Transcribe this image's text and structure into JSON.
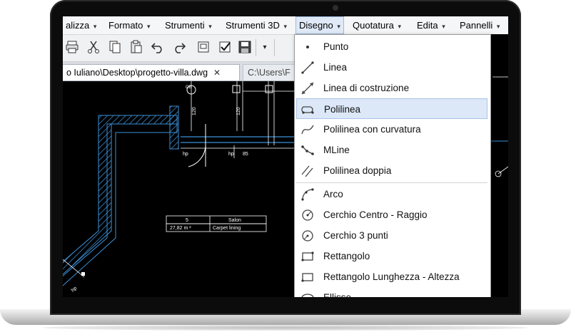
{
  "menubar": {
    "items": [
      {
        "label": "alizza",
        "arrow": "▾"
      },
      {
        "label": "Formato",
        "arrow": "▾"
      },
      {
        "label": "Strumenti",
        "arrow": "▾"
      },
      {
        "label": "Strumenti 3D",
        "arrow": "▾"
      },
      {
        "label": "Disegno",
        "arrow": "▾"
      },
      {
        "label": "Quotatura",
        "arrow": "▾"
      },
      {
        "label": "Edita",
        "arrow": "▾"
      },
      {
        "label": "Pannelli",
        "arrow": "▾"
      }
    ]
  },
  "toolbar": {
    "icons": [
      "print-icon",
      "cut-icon",
      "copy-icon",
      "paste-icon",
      "undo-icon",
      "redo-icon",
      "properties-icon",
      "checkbox-icon",
      "save-icon",
      "dropdown-icon"
    ]
  },
  "tabs": [
    {
      "label": "o Iuliano\\Desktop\\progetto-villa.dwg",
      "close": "✕"
    },
    {
      "label": "C:\\Users\\F"
    }
  ],
  "drawing": {
    "table_room_number": "5",
    "table_room_name": "Salon",
    "table_area": "27,82 m ²",
    "table_floor": "Carpet lining",
    "label_hp": "hp",
    "label_85": "85",
    "label_120": "120",
    "label_ob": "OB"
  },
  "dropdown": {
    "items": [
      {
        "label": "Punto",
        "icon": "point-icon"
      },
      {
        "label": "Linea",
        "icon": "line-icon"
      },
      {
        "label": "Linea di costruzione",
        "icon": "construction-line-icon"
      },
      {
        "label": "Polilinea",
        "icon": "polyline-icon"
      },
      {
        "label": "Polilinea con curvatura",
        "icon": "curved-polyline-icon"
      },
      {
        "label": "MLine",
        "icon": "mline-icon"
      },
      {
        "label": "Polilinea doppia",
        "icon": "double-polyline-icon"
      },
      {
        "label": "Arco",
        "icon": "arc-icon"
      },
      {
        "label": "Cerchio Centro - Raggio",
        "icon": "circle-center-radius-icon"
      },
      {
        "label": "Cerchio 3 punti",
        "icon": "circle-3-points-icon"
      },
      {
        "label": "Rettangolo",
        "icon": "rectangle-icon"
      },
      {
        "label": "Rettangolo Lunghezza - Altezza",
        "icon": "rectangle-length-height-icon"
      },
      {
        "label": "Ellisse",
        "icon": "ellipse-icon"
      }
    ]
  },
  "colors": {
    "cad_background": "#000000",
    "cad_wall": "#3b8fd6",
    "cad_lines": "#ffffff",
    "menu_highlight": "#dce8f8"
  }
}
